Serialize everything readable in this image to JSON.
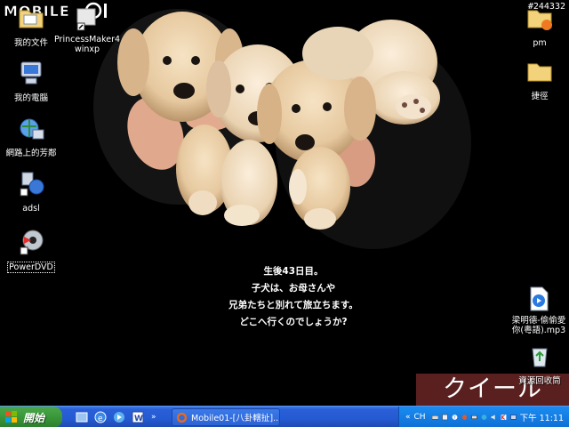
{
  "desktop": {
    "icons_left": [
      {
        "label": "我的文件",
        "icon": "folder-documents-icon"
      },
      {
        "label": "PrincessMaker4\nwinxp",
        "icon": "shortcut-icon"
      },
      {
        "label": "我的電腦",
        "icon": "computer-icon"
      },
      {
        "label": "網路上的芳鄰",
        "icon": "network-icon"
      },
      {
        "label": "adsl",
        "icon": "network-connection-icon"
      },
      {
        "label": "PowerDVD",
        "icon": "powerdvd-icon"
      }
    ],
    "icons_right": [
      {
        "label": "pm",
        "icon": "folder-icon"
      },
      {
        "label": "捷徑",
        "icon": "folder-icon"
      },
      {
        "label": "梁明德-偷偷愛\n你(粵語).mp3",
        "icon": "mp3-file-icon"
      },
      {
        "label": "資源回收筒",
        "icon": "recycle-bin-icon"
      }
    ]
  },
  "wallpaper": {
    "caption_lines": [
      "生後43日目。",
      "子犬は、お母さんや",
      "兄弟たちと別れて旅立ちます。",
      "どこへ行くのでしょうか?"
    ],
    "banner": "クイール"
  },
  "watermark": {
    "logo": "MOBILE01",
    "number": "#244332"
  },
  "taskbar": {
    "start_label": "開始",
    "quick_launch_more": "»",
    "task_label": "Mobile01-[八卦轄扯]...",
    "tray_more": "«",
    "language": "CH",
    "clock": "下午 11:11"
  },
  "colors": {
    "taskbar_blue": "#245ad2",
    "start_green": "#3a963a",
    "tray_blue": "#0f6fd6",
    "banner_red": "#5a2020"
  }
}
